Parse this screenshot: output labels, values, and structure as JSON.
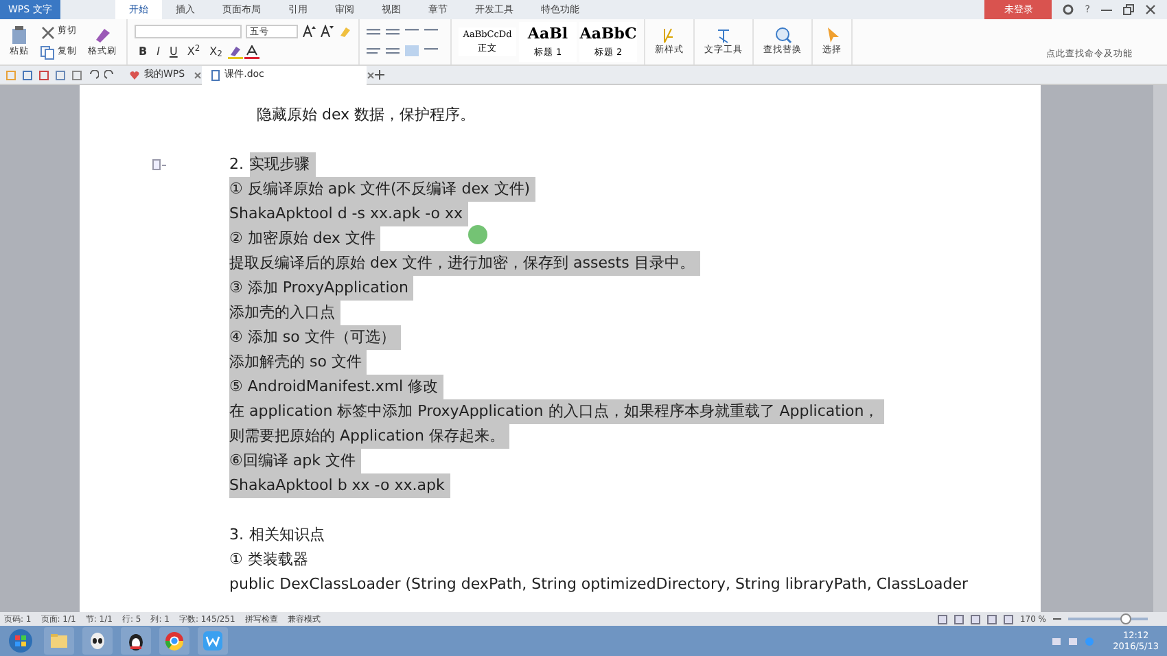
{
  "app_menu": {
    "label": "WPS 文字"
  },
  "ribbon_tabs": [
    {
      "label": "开始",
      "selected": true
    },
    {
      "label": "插入",
      "selected": false
    },
    {
      "label": "页面布局",
      "selected": false
    },
    {
      "label": "引用",
      "selected": false
    },
    {
      "label": "审阅",
      "selected": false
    },
    {
      "label": "视图",
      "selected": false
    },
    {
      "label": "章节",
      "selected": false
    },
    {
      "label": "开发工具",
      "selected": false
    },
    {
      "label": "特色功能",
      "selected": false
    }
  ],
  "login_button": "未登录",
  "help_button": "?",
  "ribbon": {
    "clipboard": [
      "粘贴",
      "剪切",
      "复制",
      "格式刷"
    ],
    "font_size": "五号",
    "format_buttons": [
      "B",
      "I",
      "U",
      "X$^{2}$",
      "X$_{2}$"
    ],
    "styles": [
      {
        "preview": "AaBbCcDd",
        "label": "正文"
      },
      {
        "preview": "AaBl",
        "label": "标题 1"
      },
      {
        "preview": "AaBbC",
        "label": "标题 2"
      }
    ],
    "tools": [
      "新样式",
      "文字工具",
      "查找替换",
      "选择"
    ],
    "command_search": {
      "placeholder": "点此查找命令及功能"
    }
  },
  "doc_tabs": [
    {
      "label": "我的WPS",
      "selected": false
    },
    {
      "label": "课件.doc",
      "selected": true
    }
  ],
  "document": {
    "lines": [
      {
        "kind": "indent",
        "text": "隐藏原始 dex 数据，保护程序。",
        "highlighted": false
      },
      {
        "kind": "heading",
        "number": "2.",
        "text": "实现步骤",
        "highlighted": true
      },
      {
        "kind": "body",
        "text": "① 反编译原始 apk 文件(不反编译 dex 文件)",
        "highlighted": true
      },
      {
        "kind": "body",
        "text": "ShakaApktool d -s xx.apk -o xx",
        "highlighted": true
      },
      {
        "kind": "body",
        "text": "② 加密原始 dex 文件",
        "highlighted": true
      },
      {
        "kind": "body",
        "text": "提取反编译后的原始 dex 文件，进行加密，保存到 assests 目录中。",
        "highlighted": true
      },
      {
        "kind": "body",
        "text": "③ 添加 ProxyApplication",
        "highlighted": true
      },
      {
        "kind": "body",
        "text": "添加壳的入口点",
        "highlighted": true
      },
      {
        "kind": "body",
        "text": "④ 添加 so 文件（可选）",
        "highlighted": true
      },
      {
        "kind": "body",
        "text": "添加解壳的 so 文件",
        "highlighted": true
      },
      {
        "kind": "body",
        "text": "⑤ AndroidManifest.xml 修改",
        "highlighted": true
      },
      {
        "kind": "body",
        "text": "在 application 标签中添加 ProxyApplication 的入口点，如果程序本身就重载了 Application，",
        "highlighted": true
      },
      {
        "kind": "body",
        "text": "则需要把原始的 Application 保存起来。",
        "highlighted": true
      },
      {
        "kind": "body",
        "text": "⑥回编译 apk 文件",
        "highlighted": true
      },
      {
        "kind": "body",
        "text": "ShakaApktool b xx -o xx.apk",
        "highlighted": true
      },
      {
        "kind": "heading",
        "number": "3.",
        "text": "相关知识点",
        "highlighted": false
      },
      {
        "kind": "body",
        "text": "① 类装载器",
        "highlighted": false
      },
      {
        "kind": "body",
        "text": "public DexClassLoader (String dexPath, String optimizedDirectory, String libraryPath, ClassLoader",
        "highlighted": false
      }
    ]
  },
  "status_bar": {
    "items": [
      "页码: 1",
      "页面: 1/1",
      "节: 1/1",
      "行: 5",
      "列: 1",
      "字数: 145/251",
      "拼写检查",
      "兼容模式"
    ],
    "zoom": "170 %",
    "zoom_slider": {
      "level": 0.72
    }
  },
  "taskbar": {
    "time": "12:12",
    "date": "2016/5/13"
  }
}
